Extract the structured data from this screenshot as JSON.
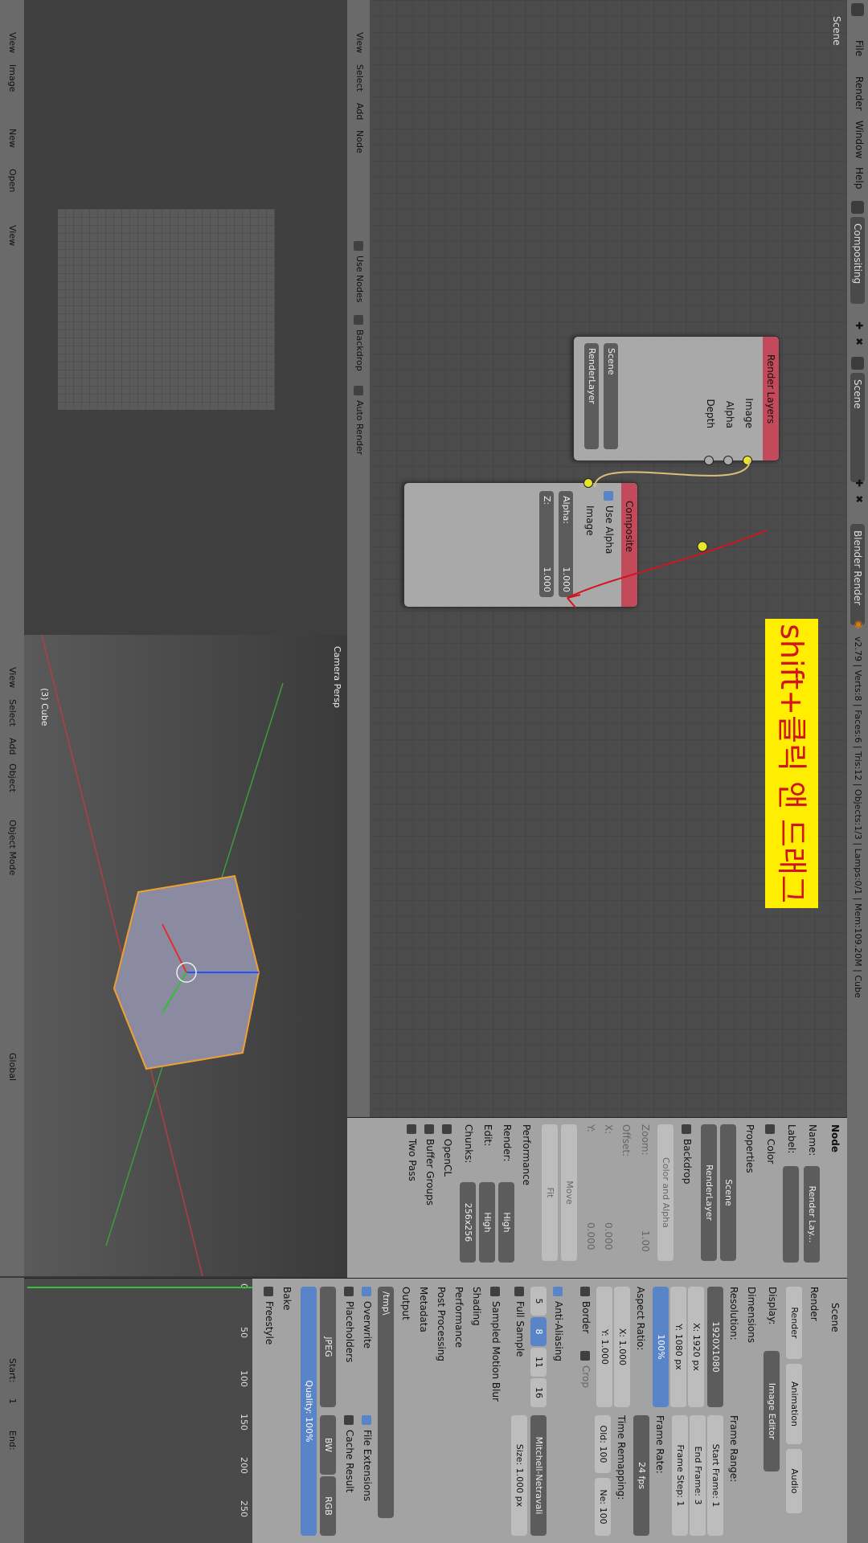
{
  "menubar": {
    "menus": [
      "File",
      "Render",
      "Window",
      "Help"
    ],
    "workspace": "Compositing",
    "scene": "Scene",
    "engine": "Blender Render",
    "stats": "v2.79 | Verts:8 | Faces:6 | Tris:12 | Objects:1/3 | Lamps:0/1 | Mem:109.20M | Cube"
  },
  "node_editor": {
    "tree_label": "Scene",
    "header": {
      "menus": [
        "View",
        "Select",
        "Add",
        "Node"
      ],
      "use_nodes": "Use Nodes",
      "backdrop": "Backdrop",
      "auto_render": "Auto Render"
    },
    "render_layers_node": {
      "title": "Render Layers",
      "outputs": [
        "Image",
        "Alpha",
        "Depth"
      ],
      "scene": "Scene",
      "layer": "RenderLayer"
    },
    "composite_node": {
      "title": "Composite",
      "use_alpha": "Use Alpha",
      "input": "Image",
      "alpha_label": "Alpha:",
      "alpha_value": "1.000",
      "z_label": "Z:",
      "z_value": "1.000"
    },
    "annotation": "shift+클릭 앤 드래그",
    "annotation_colors": {
      "bg": "#ffee00",
      "text": "#d2141e"
    }
  },
  "node_panel": {
    "header": "Node",
    "name_label": "Name:",
    "name_value": "Render Lay...",
    "label_label": "Label:",
    "color": "Color",
    "properties": "Properties",
    "scene": "Scene",
    "layer": "RenderLayer",
    "backdrop": "Backdrop",
    "color_and_alpha": "Color and Alpha",
    "zoom_label": "Zoom:",
    "zoom_value": "1.00",
    "offset": "Offset:",
    "x_label": "X:",
    "x_value": "0.000",
    "y_label": "Y:",
    "y_value": "0.000",
    "move": "Move",
    "fit": "Fit",
    "performance": "Performance",
    "render_label": "Render:",
    "render_value": "High",
    "edit_label": "Edit:",
    "edit_value": "High",
    "chunks_label": "Chunks:",
    "chunks_value": "256x256",
    "opencl": "OpenCL",
    "buffer_groups": "Buffer Groups",
    "two_pass": "Two Pass"
  },
  "image_editor": {
    "header": {
      "menus": [
        "View",
        "Image"
      ],
      "new": "New",
      "open": "Open",
      "view": "View"
    }
  },
  "viewport": {
    "camera_label": "Camera Persp",
    "object_label": "(3) Cube",
    "header": {
      "menus": [
        "View",
        "Select",
        "Add",
        "Object"
      ],
      "mode": "Object Mode",
      "orientation": "Global"
    }
  },
  "properties": {
    "context": "Scene",
    "render": "Render",
    "render_btn": "Render",
    "animation_btn": "Animation",
    "audio_btn": "Audio",
    "display_label": "Display:",
    "display_value": "Image Editor",
    "dimensions": "Dimensions",
    "resolution_label": "Resolution:",
    "preset": "1920X1080",
    "res_x_label": "X:",
    "res_x": "1920 px",
    "res_y_label": "Y:",
    "res_y": "1080 px",
    "res_pct": "100%",
    "aspect_label": "Aspect Ratio:",
    "aspect_x_label": "X:",
    "aspect_x": "1.000",
    "aspect_y_label": "Y:",
    "aspect_y": "1.000",
    "border": "Border",
    "crop": "Crop",
    "frame_range": "Frame Range:",
    "start_frame_label": "Start Frame:",
    "start_frame": "1",
    "end_frame_label": "End Frame:",
    "end_frame": "3",
    "frame_step_label": "Frame Step:",
    "frame_step": "1",
    "frame_rate_label": "Frame Rate:",
    "frame_rate": "24 fps",
    "time_remap": "Time Remapping:",
    "old_label": "Old:",
    "old_value": "100",
    "new_label": "Ne:",
    "new_value": "100",
    "anti_aliasing": "Anti-Aliasing",
    "aa_samples": [
      "5",
      "8",
      "11",
      "16"
    ],
    "aa_filter": "Mitchell-Netravali",
    "full_sample": "Full Sample",
    "size_label": "Size:",
    "size_value": "1.000 px",
    "sampled_motion_blur": "Sampled Motion Blur",
    "shading": "Shading",
    "performance": "Performance",
    "post_processing": "Post Processing",
    "metadata": "Metadata",
    "output": "Output",
    "output_path": "/tmp\\",
    "overwrite": "Overwrite",
    "file_extensions": "File Extensions",
    "placeholders": "Placeholders",
    "cache_result": "Cache Result",
    "format": "JPEG",
    "bw": "BW",
    "rgb": "RGB",
    "quality_label": "Quality:",
    "quality_value": "100%",
    "bake": "Bake",
    "freestyle": "Freestyle"
  },
  "timeline": {
    "ticks": [
      "0",
      "50",
      "100",
      "150",
      "200",
      "250"
    ],
    "start_label": "Start:",
    "start_value": "1",
    "end_label": "End:"
  }
}
